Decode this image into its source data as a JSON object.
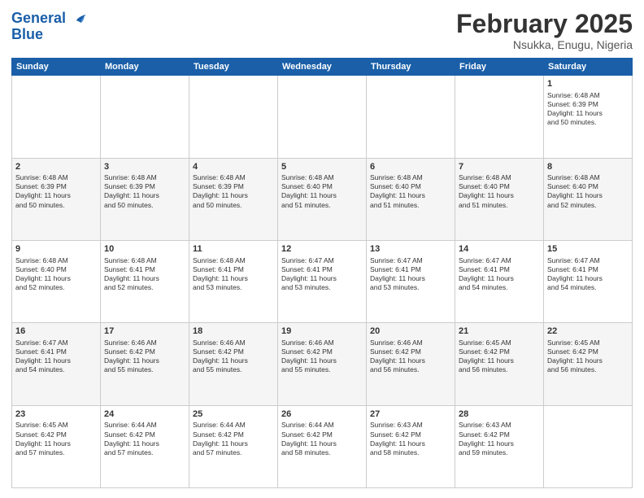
{
  "logo": {
    "text_general": "General",
    "text_blue": "Blue"
  },
  "header": {
    "month": "February 2025",
    "location": "Nsukka, Enugu, Nigeria"
  },
  "weekdays": [
    "Sunday",
    "Monday",
    "Tuesday",
    "Wednesday",
    "Thursday",
    "Friday",
    "Saturday"
  ],
  "weeks": [
    [
      {
        "day": "",
        "detail": ""
      },
      {
        "day": "",
        "detail": ""
      },
      {
        "day": "",
        "detail": ""
      },
      {
        "day": "",
        "detail": ""
      },
      {
        "day": "",
        "detail": ""
      },
      {
        "day": "",
        "detail": ""
      },
      {
        "day": "1",
        "detail": "Sunrise: 6:48 AM\nSunset: 6:39 PM\nDaylight: 11 hours\nand 50 minutes."
      }
    ],
    [
      {
        "day": "2",
        "detail": "Sunrise: 6:48 AM\nSunset: 6:39 PM\nDaylight: 11 hours\nand 50 minutes."
      },
      {
        "day": "3",
        "detail": "Sunrise: 6:48 AM\nSunset: 6:39 PM\nDaylight: 11 hours\nand 50 minutes."
      },
      {
        "day": "4",
        "detail": "Sunrise: 6:48 AM\nSunset: 6:39 PM\nDaylight: 11 hours\nand 50 minutes."
      },
      {
        "day": "5",
        "detail": "Sunrise: 6:48 AM\nSunset: 6:40 PM\nDaylight: 11 hours\nand 51 minutes."
      },
      {
        "day": "6",
        "detail": "Sunrise: 6:48 AM\nSunset: 6:40 PM\nDaylight: 11 hours\nand 51 minutes."
      },
      {
        "day": "7",
        "detail": "Sunrise: 6:48 AM\nSunset: 6:40 PM\nDaylight: 11 hours\nand 51 minutes."
      },
      {
        "day": "8",
        "detail": "Sunrise: 6:48 AM\nSunset: 6:40 PM\nDaylight: 11 hours\nand 52 minutes."
      }
    ],
    [
      {
        "day": "9",
        "detail": "Sunrise: 6:48 AM\nSunset: 6:40 PM\nDaylight: 11 hours\nand 52 minutes."
      },
      {
        "day": "10",
        "detail": "Sunrise: 6:48 AM\nSunset: 6:41 PM\nDaylight: 11 hours\nand 52 minutes."
      },
      {
        "day": "11",
        "detail": "Sunrise: 6:48 AM\nSunset: 6:41 PM\nDaylight: 11 hours\nand 53 minutes."
      },
      {
        "day": "12",
        "detail": "Sunrise: 6:47 AM\nSunset: 6:41 PM\nDaylight: 11 hours\nand 53 minutes."
      },
      {
        "day": "13",
        "detail": "Sunrise: 6:47 AM\nSunset: 6:41 PM\nDaylight: 11 hours\nand 53 minutes."
      },
      {
        "day": "14",
        "detail": "Sunrise: 6:47 AM\nSunset: 6:41 PM\nDaylight: 11 hours\nand 54 minutes."
      },
      {
        "day": "15",
        "detail": "Sunrise: 6:47 AM\nSunset: 6:41 PM\nDaylight: 11 hours\nand 54 minutes."
      }
    ],
    [
      {
        "day": "16",
        "detail": "Sunrise: 6:47 AM\nSunset: 6:41 PM\nDaylight: 11 hours\nand 54 minutes."
      },
      {
        "day": "17",
        "detail": "Sunrise: 6:46 AM\nSunset: 6:42 PM\nDaylight: 11 hours\nand 55 minutes."
      },
      {
        "day": "18",
        "detail": "Sunrise: 6:46 AM\nSunset: 6:42 PM\nDaylight: 11 hours\nand 55 minutes."
      },
      {
        "day": "19",
        "detail": "Sunrise: 6:46 AM\nSunset: 6:42 PM\nDaylight: 11 hours\nand 55 minutes."
      },
      {
        "day": "20",
        "detail": "Sunrise: 6:46 AM\nSunset: 6:42 PM\nDaylight: 11 hours\nand 56 minutes."
      },
      {
        "day": "21",
        "detail": "Sunrise: 6:45 AM\nSunset: 6:42 PM\nDaylight: 11 hours\nand 56 minutes."
      },
      {
        "day": "22",
        "detail": "Sunrise: 6:45 AM\nSunset: 6:42 PM\nDaylight: 11 hours\nand 56 minutes."
      }
    ],
    [
      {
        "day": "23",
        "detail": "Sunrise: 6:45 AM\nSunset: 6:42 PM\nDaylight: 11 hours\nand 57 minutes."
      },
      {
        "day": "24",
        "detail": "Sunrise: 6:44 AM\nSunset: 6:42 PM\nDaylight: 11 hours\nand 57 minutes."
      },
      {
        "day": "25",
        "detail": "Sunrise: 6:44 AM\nSunset: 6:42 PM\nDaylight: 11 hours\nand 57 minutes."
      },
      {
        "day": "26",
        "detail": "Sunrise: 6:44 AM\nSunset: 6:42 PM\nDaylight: 11 hours\nand 58 minutes."
      },
      {
        "day": "27",
        "detail": "Sunrise: 6:43 AM\nSunset: 6:42 PM\nDaylight: 11 hours\nand 58 minutes."
      },
      {
        "day": "28",
        "detail": "Sunrise: 6:43 AM\nSunset: 6:42 PM\nDaylight: 11 hours\nand 59 minutes."
      },
      {
        "day": "",
        "detail": ""
      }
    ]
  ]
}
